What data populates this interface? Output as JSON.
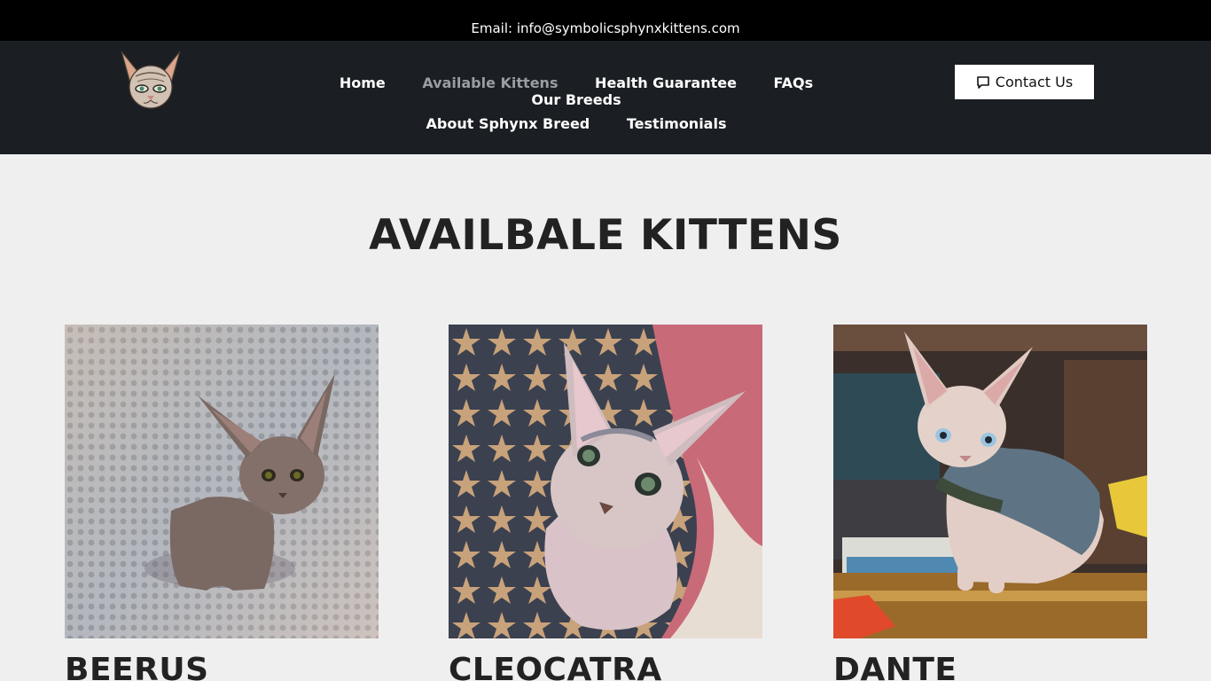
{
  "topbar": {
    "email_text": "Email: info@symbolicsphynxkittens.com"
  },
  "header": {
    "logo_icon": "sphynx-cat-face-logo",
    "nav_row1": [
      {
        "label": "Home",
        "active": false
      },
      {
        "label": "Available Kittens",
        "active": true
      },
      {
        "label": "Health Guarantee",
        "active": false
      },
      {
        "label": "FAQs",
        "active": false
      },
      {
        "label": "Our Breeds",
        "active": false
      }
    ],
    "nav_row2": [
      {
        "label": "About Sphynx Breed",
        "active": false
      },
      {
        "label": "Testimonials",
        "active": false
      }
    ],
    "contact_button": {
      "label": "Contact Us",
      "icon": "chat-bubble-icon"
    }
  },
  "main": {
    "title": "AVAILBALE KITTENS",
    "kittens": [
      {
        "name": "BEERUS"
      },
      {
        "name": "CLEOCATRA"
      },
      {
        "name": "DANTE"
      }
    ]
  },
  "colors": {
    "topbar_bg": "#000000",
    "header_bg": "#1b1f24",
    "page_bg": "#efefef",
    "active_nav": "#9a9ea3"
  }
}
